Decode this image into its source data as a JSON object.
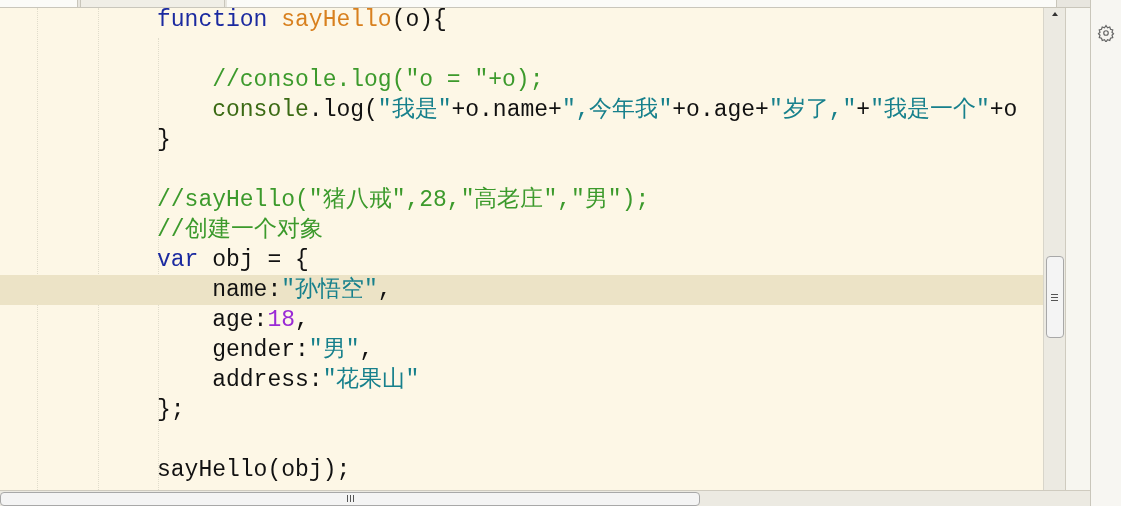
{
  "tabs": [
    {
      "selected": false
    },
    {
      "selected": true
    },
    {
      "selected": false
    }
  ],
  "editor": {
    "lines": [
      {
        "kind": "code",
        "current": false,
        "tokens": [
          {
            "kind": "keyword",
            "text": "function"
          },
          {
            "kind": "function",
            "text": " sayHello"
          },
          {
            "kind": "plain",
            "text": "(o){"
          }
        ]
      },
      {
        "kind": "blank",
        "current": false
      },
      {
        "kind": "code",
        "current": false,
        "tokens": [
          {
            "kind": "comment",
            "text": "    //console.log(\"o = \"+o);"
          }
        ]
      },
      {
        "kind": "code",
        "current": false,
        "tokens": [
          {
            "kind": "ident",
            "text": "    console"
          },
          {
            "kind": "plain",
            "text": ".log("
          },
          {
            "kind": "string",
            "text": "\"我是\""
          },
          {
            "kind": "plain",
            "text": "+o.name+"
          },
          {
            "kind": "string",
            "text": "\",今年我\""
          },
          {
            "kind": "plain",
            "text": "+o.age+"
          },
          {
            "kind": "string",
            "text": "\"岁了,\""
          },
          {
            "kind": "plain",
            "text": "+"
          },
          {
            "kind": "string",
            "text": "\"我是一个\""
          },
          {
            "kind": "plain",
            "text": "+o"
          }
        ]
      },
      {
        "kind": "code",
        "current": false,
        "tokens": [
          {
            "kind": "plain",
            "text": "}"
          }
        ]
      },
      {
        "kind": "blank",
        "current": false
      },
      {
        "kind": "code",
        "current": false,
        "tokens": [
          {
            "kind": "comment",
            "text": "//sayHello(\"猪八戒\",28,\"高老庄\",\"男\");"
          }
        ]
      },
      {
        "kind": "code",
        "current": false,
        "tokens": [
          {
            "kind": "comment",
            "text": "//创建一个对象"
          }
        ]
      },
      {
        "kind": "code",
        "current": false,
        "tokens": [
          {
            "kind": "keyword",
            "text": "var"
          },
          {
            "kind": "plain",
            "text": " obj = {"
          }
        ]
      },
      {
        "kind": "code",
        "current": true,
        "tokens": [
          {
            "kind": "plain",
            "text": "    name:"
          },
          {
            "kind": "string",
            "text": "\"孙悟空\""
          },
          {
            "kind": "plain",
            "text": ","
          }
        ]
      },
      {
        "kind": "code",
        "current": false,
        "tokens": [
          {
            "kind": "plain",
            "text": "    age:"
          },
          {
            "kind": "number",
            "text": "18"
          },
          {
            "kind": "plain",
            "text": ","
          }
        ]
      },
      {
        "kind": "code",
        "current": false,
        "tokens": [
          {
            "kind": "plain",
            "text": "    gender:"
          },
          {
            "kind": "string",
            "text": "\"男\""
          },
          {
            "kind": "plain",
            "text": ","
          }
        ]
      },
      {
        "kind": "code",
        "current": false,
        "tokens": [
          {
            "kind": "plain",
            "text": "    address:"
          },
          {
            "kind": "string",
            "text": "\"花果山\""
          }
        ]
      },
      {
        "kind": "code",
        "current": false,
        "tokens": [
          {
            "kind": "plain",
            "text": "};"
          }
        ]
      },
      {
        "kind": "blank",
        "current": false
      },
      {
        "kind": "code",
        "current": false,
        "tokens": [
          {
            "kind": "plain",
            "text": "sayHello(obj);"
          }
        ]
      }
    ]
  }
}
